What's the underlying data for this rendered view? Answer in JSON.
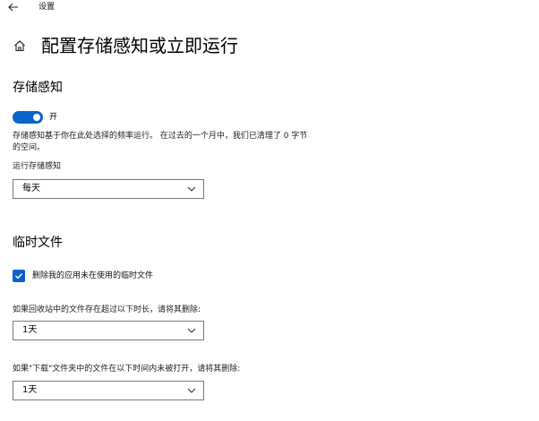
{
  "window": {
    "app_title": "设置"
  },
  "header": {
    "title": "配置存储感知或立即运行"
  },
  "storage_sense": {
    "section_title": "存储感知",
    "toggle_state_label": "开",
    "description": "存储感知基于你在此处选择的频率运行。 在过去的一个月中，我们已清理了 0 字节 的空间。",
    "run_label": "运行存储感知",
    "run_selected": "每天"
  },
  "temp_files": {
    "section_title": "临时文件",
    "delete_temp_label": "删除我的应用未在使用的临时文件",
    "delete_temp_checked": true,
    "recycle_label": "如果回收站中的文件存在超过以下时长，请将其删除:",
    "recycle_selected": "1天",
    "downloads_label": "如果\"下载\"文件夹中的文件在以下时间内未被打开，请将其删除:",
    "downloads_selected": "1天"
  },
  "colors": {
    "accent": "#0a64c8"
  }
}
